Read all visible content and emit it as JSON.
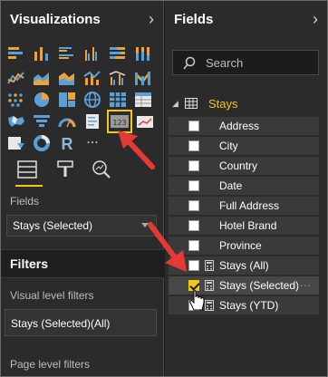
{
  "visualizations": {
    "title": "Visualizations",
    "icons": [
      "stacked-bar-icon",
      "stacked-column-icon",
      "clustered-bar-icon",
      "clustered-column-icon",
      "100-bar-icon",
      "100-column-icon",
      "line-chart-icon",
      "area-chart-icon",
      "stacked-area-icon",
      "line-column-icon",
      "line-clustered-icon",
      "ribbon-icon",
      "waterfall-icon",
      "scatter-icon",
      "pie-icon",
      "donut-icon",
      "treemap-icon",
      "map-icon",
      "filled-map-icon",
      "funnel-icon",
      "gauge-icon",
      "card-icon",
      "multirow-card-icon",
      "kpi-icon",
      "slicer-icon",
      "donut2-icon",
      "r-icon",
      "more-icon"
    ],
    "selected_icon": "card-icon",
    "tabs": [
      "fields-tab",
      "format-tab",
      "analytics-tab"
    ]
  },
  "fields_well": {
    "label": "Fields",
    "value": "Stays (Selected)"
  },
  "filters": {
    "title": "Filters",
    "visual_label": "Visual level filters",
    "visual_value": "Stays (Selected)(All)",
    "page_label": "Page level filters"
  },
  "fields_pane": {
    "title": "Fields",
    "search_placeholder": "Search",
    "table_name": "Stays",
    "items": [
      {
        "name": "Address",
        "checked": false,
        "calc": false
      },
      {
        "name": "City",
        "checked": false,
        "calc": false
      },
      {
        "name": "Country",
        "checked": false,
        "calc": false
      },
      {
        "name": "Date",
        "checked": false,
        "calc": false
      },
      {
        "name": "Full Address",
        "checked": false,
        "calc": false
      },
      {
        "name": "Hotel Brand",
        "checked": false,
        "calc": false
      },
      {
        "name": "Province",
        "checked": false,
        "calc": false
      },
      {
        "name": "Stays (All)",
        "checked": false,
        "calc": true
      },
      {
        "name": "Stays (Selected)",
        "checked": true,
        "calc": true
      },
      {
        "name": "Stays (YTD)",
        "checked": false,
        "calc": true
      }
    ],
    "more_dots": "...."
  },
  "more_label": "···",
  "r_label": "R",
  "colors": {
    "accent": "#f2c811",
    "annotation": "#e53935"
  }
}
